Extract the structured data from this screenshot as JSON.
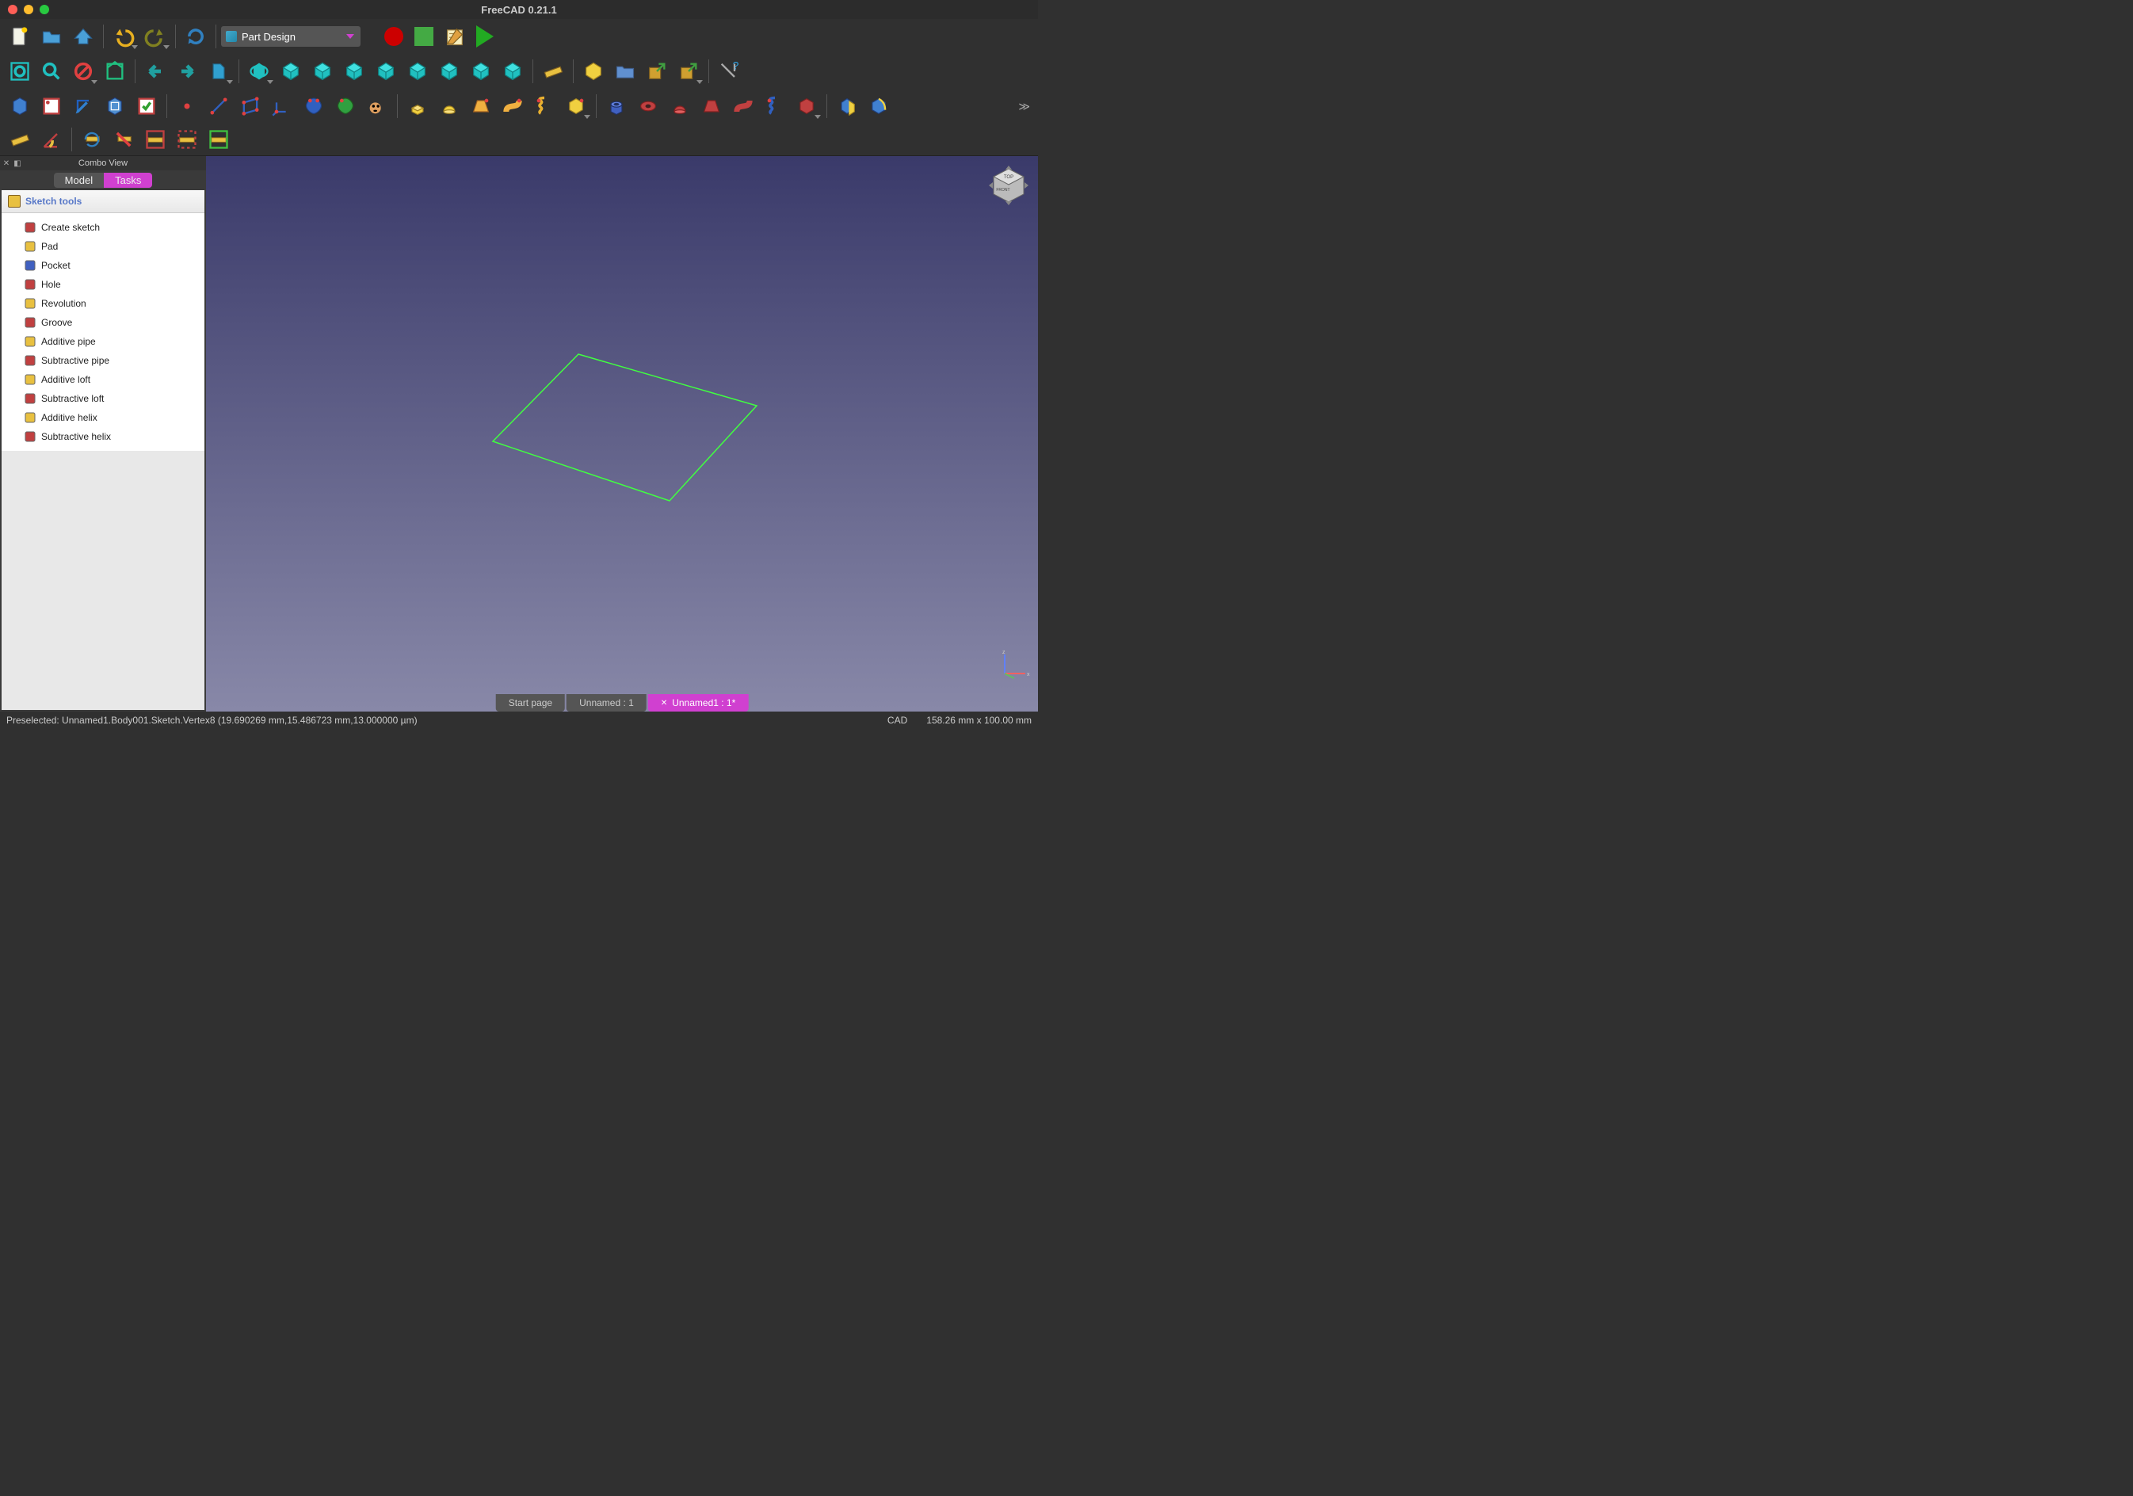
{
  "app": {
    "title": "FreeCAD 0.21.1"
  },
  "workbench_selector": {
    "value": "Part Design"
  },
  "toolbar_row1": [
    {
      "name": "new-file-icon",
      "svg": "doc-new"
    },
    {
      "name": "open-file-icon",
      "svg": "folder-open"
    },
    {
      "name": "save-icon",
      "svg": "save"
    },
    {
      "sep": true
    },
    {
      "name": "undo-icon",
      "svg": "undo",
      "dd": true
    },
    {
      "name": "redo-icon",
      "svg": "redo",
      "dd": true
    },
    {
      "sep": true
    },
    {
      "name": "refresh-icon",
      "svg": "refresh"
    }
  ],
  "toolbar_row2": [
    {
      "name": "fit-all-icon",
      "svg": "fit-all"
    },
    {
      "name": "fit-selection-icon",
      "svg": "fit-sel"
    },
    {
      "name": "draw-style-icon",
      "svg": "draw-style",
      "dd": true
    },
    {
      "name": "bounding-box-icon",
      "svg": "bbox"
    },
    {
      "sep": true
    },
    {
      "name": "nav-back-icon",
      "svg": "arrow-left"
    },
    {
      "name": "nav-forward-icon",
      "svg": "arrow-right"
    },
    {
      "name": "link-nav-icon",
      "svg": "link-cube",
      "dd": true
    },
    {
      "sep": true
    },
    {
      "name": "isometric-icon",
      "svg": "iso",
      "dd": true
    },
    {
      "name": "front-view-icon",
      "svg": "cube1"
    },
    {
      "name": "top-view-icon",
      "svg": "cube2"
    },
    {
      "name": "right-view-icon",
      "svg": "cube3"
    },
    {
      "name": "rear-view-icon",
      "svg": "cube4"
    },
    {
      "name": "bottom-view-icon",
      "svg": "cube5"
    },
    {
      "name": "left-view-icon",
      "svg": "cube6"
    },
    {
      "name": "rotate-left-icon",
      "svg": "cube7"
    },
    {
      "name": "rotate-right-icon",
      "svg": "cube8"
    },
    {
      "sep": true
    },
    {
      "name": "measure-icon",
      "svg": "ruler"
    },
    {
      "sep": true
    },
    {
      "name": "part-icon",
      "svg": "part"
    },
    {
      "name": "group-icon",
      "svg": "folder"
    },
    {
      "name": "link-icon",
      "svg": "link-out"
    },
    {
      "name": "link-actions-icon",
      "svg": "link-out2",
      "dd": true
    },
    {
      "sep": true
    },
    {
      "name": "whatsthis-icon",
      "svg": "whats"
    }
  ],
  "toolbar_row3": [
    {
      "name": "create-body-icon",
      "svg": "body"
    },
    {
      "name": "create-sketch-icon",
      "svg": "sketch"
    },
    {
      "name": "edit-sketch-icon",
      "svg": "edit-sketch"
    },
    {
      "name": "map-sketch-icon",
      "svg": "map-sketch"
    },
    {
      "name": "validate-sketch-icon",
      "svg": "validate"
    },
    {
      "sep": true
    },
    {
      "name": "datum-point-icon",
      "svg": "point"
    },
    {
      "name": "datum-line-icon",
      "svg": "line"
    },
    {
      "name": "datum-plane-icon",
      "svg": "plane"
    },
    {
      "name": "local-cs-icon",
      "svg": "lcs"
    },
    {
      "name": "shape-binder-icon",
      "svg": "binder"
    },
    {
      "name": "sub-shape-binder-icon",
      "svg": "sub-binder"
    },
    {
      "name": "clone-icon",
      "svg": "clone"
    },
    {
      "sep": true
    },
    {
      "name": "pad-icon",
      "svg": "pad"
    },
    {
      "name": "revolution-icon",
      "svg": "revolution"
    },
    {
      "name": "additive-loft-icon",
      "svg": "add-loft"
    },
    {
      "name": "additive-pipe-icon",
      "svg": "add-pipe"
    },
    {
      "name": "additive-helix-icon",
      "svg": "add-helix"
    },
    {
      "name": "additive-primitive-icon",
      "svg": "add-prim",
      "dd": true
    },
    {
      "sep": true
    },
    {
      "name": "pocket-icon",
      "svg": "pocket"
    },
    {
      "name": "hole-icon",
      "svg": "hole"
    },
    {
      "name": "groove-icon",
      "svg": "groove"
    },
    {
      "name": "subtractive-loft-icon",
      "svg": "sub-loft"
    },
    {
      "name": "subtractive-pipe-icon",
      "svg": "sub-pipe"
    },
    {
      "name": "subtractive-helix-icon",
      "svg": "sub-helix"
    },
    {
      "name": "subtractive-primitive-icon",
      "svg": "sub-prim",
      "dd": true
    },
    {
      "sep": true
    },
    {
      "name": "boolean-icon",
      "svg": "boolean"
    },
    {
      "name": "fillet-partdesign-icon",
      "svg": "fillet-pd"
    }
  ],
  "toolbar_row4": [
    {
      "name": "measure-linear-icon",
      "svg": "meas-lin"
    },
    {
      "name": "measure-angular-icon",
      "svg": "meas-ang"
    },
    {
      "sep": true
    },
    {
      "name": "measure-refresh-icon",
      "svg": "meas-ref"
    },
    {
      "name": "measure-clear-icon",
      "svg": "meas-clr"
    },
    {
      "name": "measure-toggle-all-icon",
      "svg": "meas-tog"
    },
    {
      "name": "measure-toggle-3d-icon",
      "svg": "meas-3d"
    },
    {
      "name": "measure-toggle-delta-icon",
      "svg": "meas-delta"
    }
  ],
  "combo_view": {
    "title": "Combo View",
    "tabs": [
      {
        "label": "Model",
        "active": false
      },
      {
        "label": "Tasks",
        "active": true
      }
    ],
    "section_title": "Sketch tools",
    "items": [
      {
        "icon": "create-sketch-icon",
        "label": "Create sketch",
        "color": "#c04040"
      },
      {
        "icon": "pad-icon",
        "label": "Pad",
        "color": "#e8c040"
      },
      {
        "icon": "pocket-icon",
        "label": "Pocket",
        "color": "#4060c0"
      },
      {
        "icon": "hole-icon",
        "label": "Hole",
        "color": "#c04040"
      },
      {
        "icon": "revolution-icon",
        "label": "Revolution",
        "color": "#e8c040"
      },
      {
        "icon": "groove-icon",
        "label": "Groove",
        "color": "#c04040"
      },
      {
        "icon": "additive-pipe-icon",
        "label": "Additive pipe",
        "color": "#e8c040"
      },
      {
        "icon": "subtractive-pipe-icon",
        "label": "Subtractive pipe",
        "color": "#c04040"
      },
      {
        "icon": "additive-loft-icon",
        "label": "Additive loft",
        "color": "#e8c040"
      },
      {
        "icon": "subtractive-loft-icon",
        "label": "Subtractive loft",
        "color": "#c04040"
      },
      {
        "icon": "additive-helix-icon",
        "label": "Additive helix",
        "color": "#e8c040"
      },
      {
        "icon": "subtractive-helix-icon",
        "label": "Subtractive helix",
        "color": "#c04040"
      }
    ]
  },
  "doc_tabs": [
    {
      "label": "Start page",
      "active": false,
      "closable": false
    },
    {
      "label": "Unnamed : 1",
      "active": false,
      "closable": false
    },
    {
      "label": "Unnamed1 : 1*",
      "active": true,
      "closable": true
    }
  ],
  "status": {
    "left": "Preselected: Unnamed1.Body001.Sketch.Vertex8 (19.690269 mm,15.486723 mm,13.000000 µm)",
    "nav": "CAD",
    "dims": "158.26 mm x 100.00 mm"
  },
  "colors": {
    "accent": "#d040d0"
  }
}
